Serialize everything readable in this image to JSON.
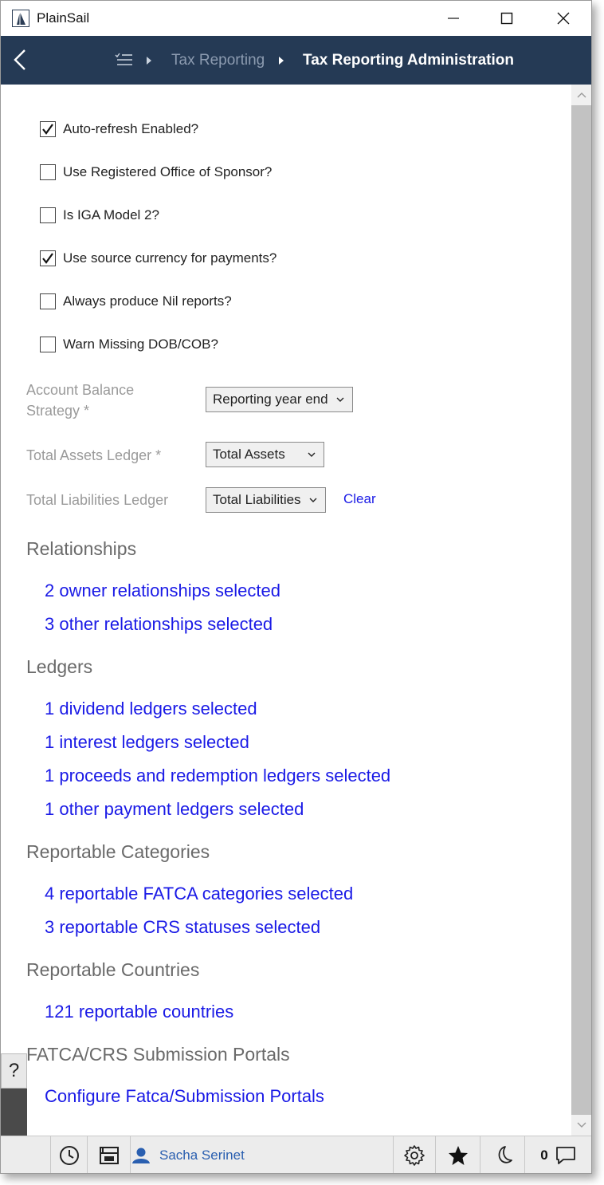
{
  "window": {
    "title": "PlainSail"
  },
  "nav": {
    "breadcrumb_parent": "Tax Reporting",
    "breadcrumb_current": "Tax Reporting Administration"
  },
  "options": [
    {
      "label": "Auto-refresh Enabled?",
      "checked": true
    },
    {
      "label": "Use Registered Office of Sponsor?",
      "checked": false
    },
    {
      "label": "Is IGA Model 2?",
      "checked": false
    },
    {
      "label": "Use source currency for payments?",
      "checked": true
    },
    {
      "label": "Always produce Nil reports?",
      "checked": false
    },
    {
      "label": "Warn Missing DOB/COB?",
      "checked": false
    }
  ],
  "fields": {
    "account_balance_strategy": {
      "label_line1": "Account Balance",
      "label_line2": "Strategy *",
      "value": "Reporting year end"
    },
    "total_assets_ledger": {
      "label": "Total Assets Ledger *",
      "value": "Total Assets"
    },
    "total_liabilities_ledger": {
      "label": "Total Liabilities Ledger",
      "value": "Total Liabilities",
      "clear_label": "Clear"
    }
  },
  "sections": {
    "relationships": {
      "title": "Relationships",
      "links": [
        "2 owner relationships selected",
        "3 other relationships selected"
      ]
    },
    "ledgers": {
      "title": "Ledgers",
      "links": [
        "1 dividend ledgers selected",
        "1 interest ledgers selected",
        "1 proceeds and redemption ledgers selected",
        "1 other payment ledgers selected"
      ]
    },
    "categories": {
      "title": "Reportable Categories",
      "links": [
        "4 reportable FATCA categories selected",
        "3 reportable CRS statuses selected"
      ]
    },
    "countries": {
      "title": "Reportable Countries",
      "links": [
        "121 reportable countries"
      ]
    },
    "portals": {
      "title": "FATCA/CRS Submission Portals",
      "links": [
        "Configure Fatca/Submission Portals"
      ]
    }
  },
  "side": {
    "help_label": "?"
  },
  "statusbar": {
    "user_name": "Sacha Serinet",
    "notification_count": "0"
  },
  "colors": {
    "nav_background": "#253a55",
    "link": "#1a1ae6",
    "section_title": "#6a6a6a",
    "field_label": "#9a9a9a",
    "user_name": "#2a5fb0"
  },
  "icons": [
    "app-logo-icon",
    "minimize-icon",
    "maximize-icon",
    "close-icon",
    "back-arrow-icon",
    "checklist-icon",
    "chevron-right-icon",
    "chevron-down-icon",
    "checkmark-icon",
    "help-icon",
    "history-icon",
    "archive-icon",
    "user-icon",
    "gear-icon",
    "star-icon",
    "moon-icon",
    "chat-icon",
    "scroll-up-icon",
    "scroll-down-icon"
  ]
}
